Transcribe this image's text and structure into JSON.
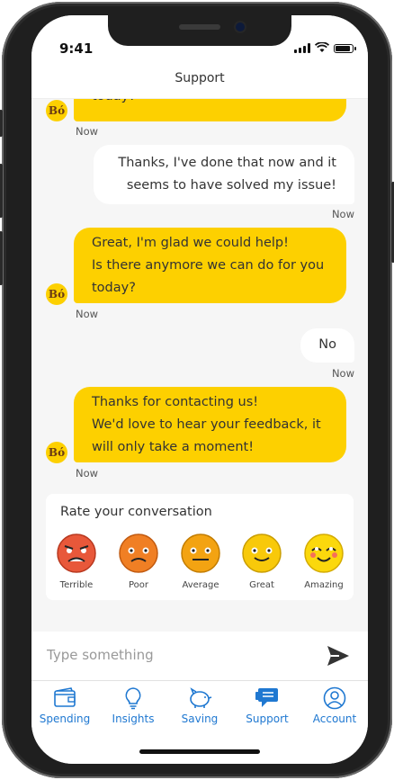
{
  "status": {
    "time": "9:41"
  },
  "header": {
    "title": "Support"
  },
  "avatar_text": "Bó",
  "messages": [
    {
      "from": "agent",
      "lines": [
        "today?"
      ],
      "time": "Now"
    },
    {
      "from": "user",
      "lines": [
        "Thanks, I've done that now and  it",
        "seems to have solved my issue!"
      ],
      "time": "Now"
    },
    {
      "from": "agent",
      "lines": [
        "Great, I'm glad we could help!",
        "Is there anymore we can do for you",
        "today?"
      ],
      "time": "Now"
    },
    {
      "from": "user",
      "lines": [
        "No"
      ],
      "time": "Now"
    },
    {
      "from": "agent",
      "lines": [
        "Thanks for contacting us!",
        "We'd love to hear your feedback, it",
        "will only take a moment!"
      ],
      "time": "Now"
    }
  ],
  "rating": {
    "title": "Rate your conversation",
    "options": [
      {
        "label": "Terrible",
        "color": "#e8583a"
      },
      {
        "label": "Poor",
        "color": "#f07f24"
      },
      {
        "label": "Average",
        "color": "#f3a312"
      },
      {
        "label": "Great",
        "color": "#f8c90a"
      },
      {
        "label": "Amazing",
        "color": "#fbd80c"
      }
    ]
  },
  "composer": {
    "placeholder": "Type something"
  },
  "tabs": [
    {
      "label": "Spending",
      "icon": "wallet-icon"
    },
    {
      "label": "Insights",
      "icon": "lightbulb-icon"
    },
    {
      "label": "Saving",
      "icon": "piggy-bank-icon"
    },
    {
      "label": "Support",
      "icon": "chat-icon",
      "active": true
    },
    {
      "label": "Account",
      "icon": "user-icon"
    }
  ],
  "colors": {
    "accent": "#fdd000",
    "tab": "#1f78d1"
  }
}
